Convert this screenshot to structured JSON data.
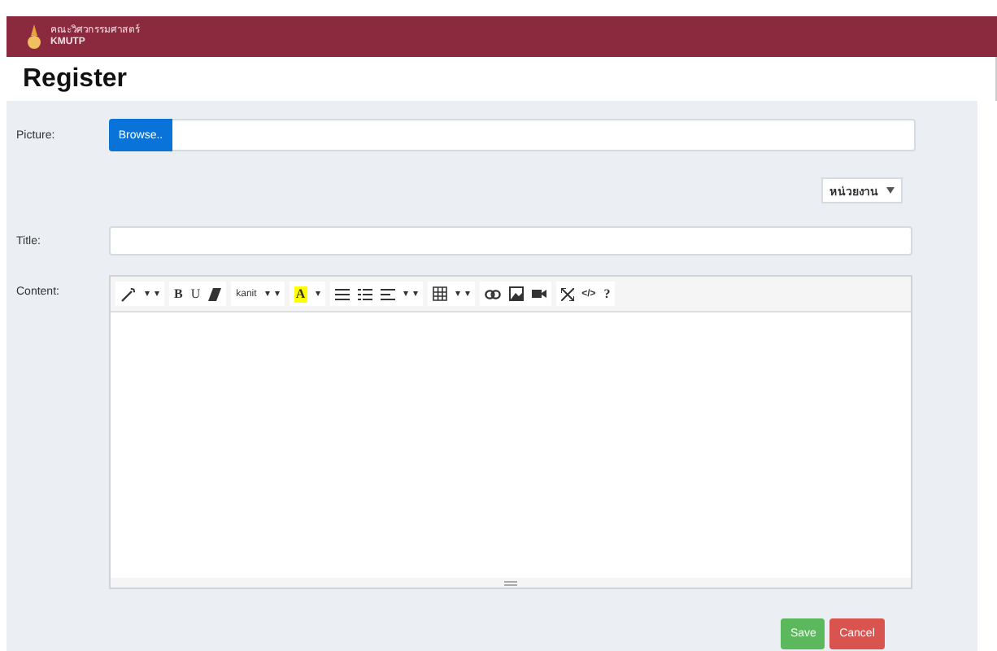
{
  "header": {
    "org_name": "คณะวิศวกรรมศาสตร์",
    "org_code": "KMUTP"
  },
  "page_title": "Register",
  "form": {
    "picture_label": "Picture:",
    "browse_button": "Browse..",
    "unit_select": "หน่วยงาน",
    "title_label": "Title:",
    "content_label": "Content:"
  },
  "editor": {
    "bold": "B",
    "underline": "U",
    "font": "kanit",
    "text_color_letter": "A",
    "code": "</>",
    "help": "?"
  },
  "buttons": {
    "save": "Save",
    "cancel": "Cancel"
  }
}
